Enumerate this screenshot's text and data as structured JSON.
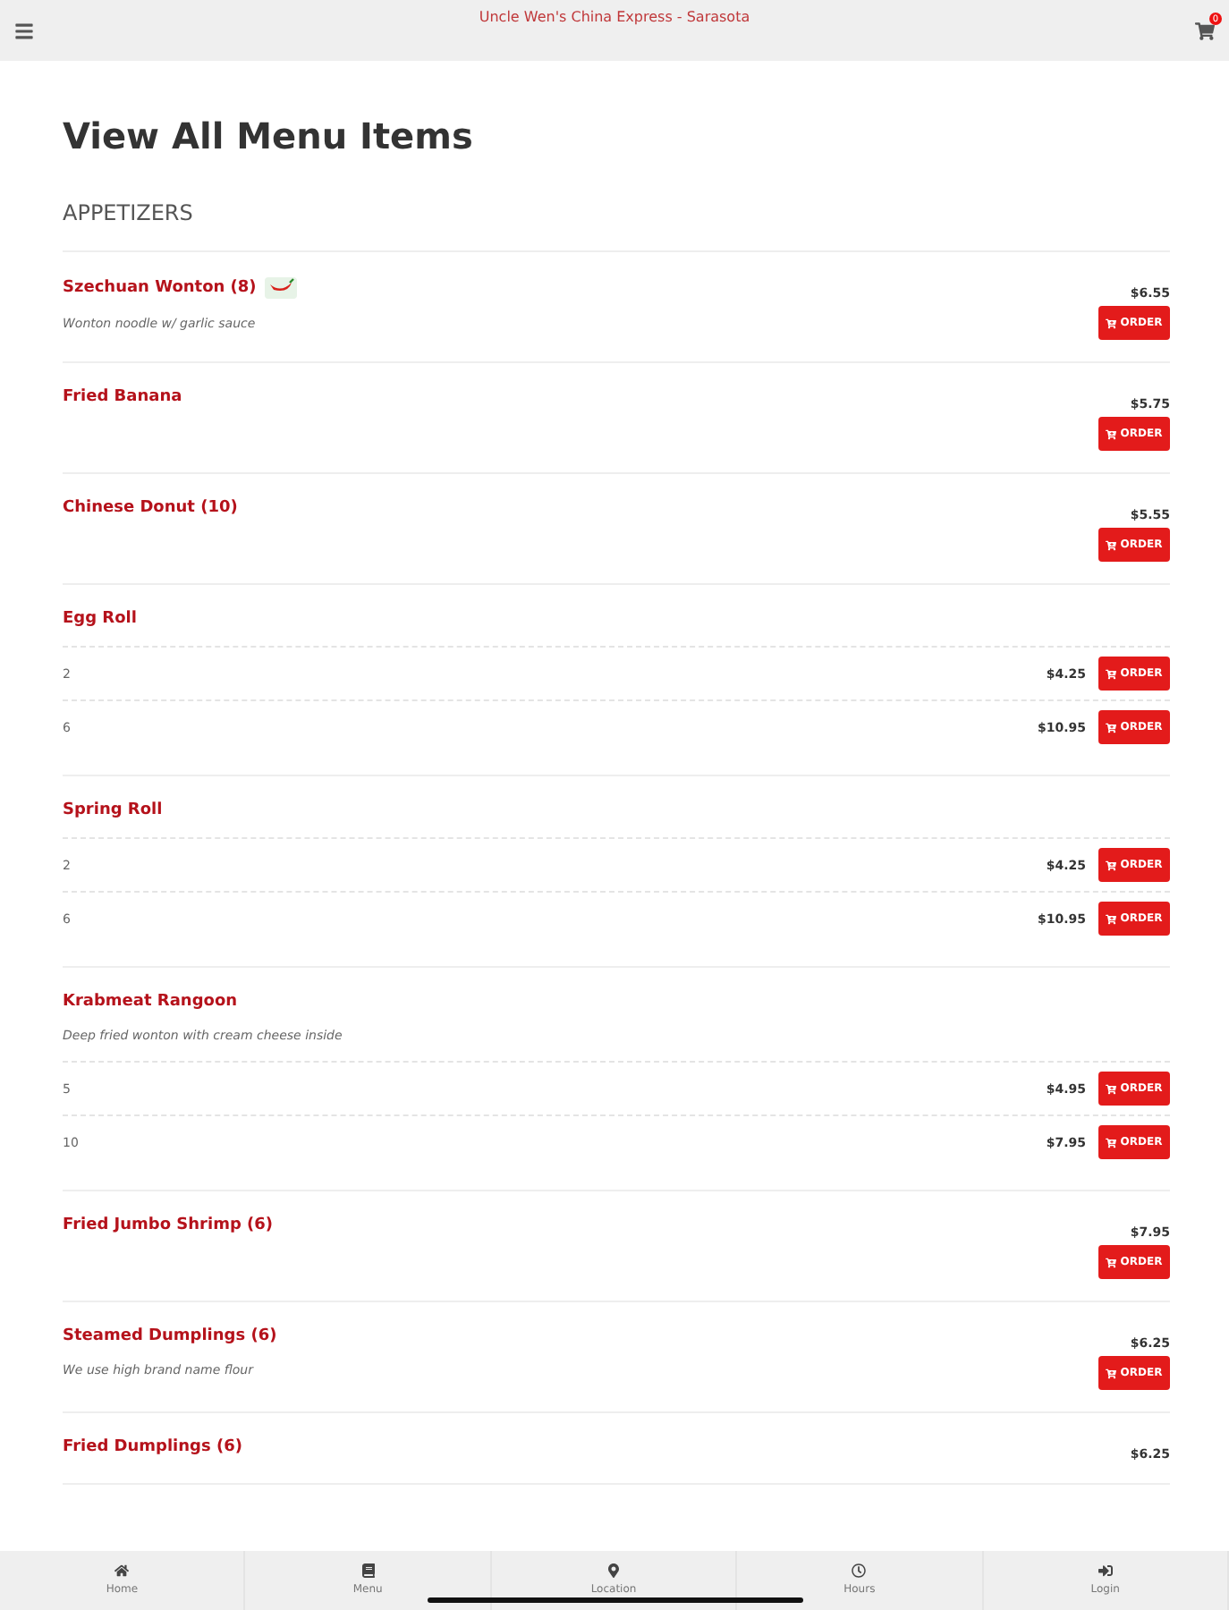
{
  "header": {
    "title": "Uncle Wen's China Express - Sarasota",
    "cart_count": "0"
  },
  "page_title": "View All Menu Items",
  "section": "APPETIZERS",
  "items": [
    {
      "kind": "single",
      "name": "Szechuan Wonton (8)",
      "spicy": true,
      "description": "Wonton noodle w/ garlic sauce",
      "price": "$6.55",
      "order": "ORDER"
    },
    {
      "kind": "single",
      "name": "Fried Banana",
      "spicy": false,
      "price": "$5.75",
      "order": "ORDER"
    },
    {
      "kind": "single",
      "name": "Chinese Donut (10)",
      "spicy": false,
      "price": "$5.55",
      "order": "ORDER"
    },
    {
      "kind": "multi",
      "name": "Egg Roll",
      "spicy": false,
      "options": [
        {
          "size": "2",
          "price": "$4.25",
          "order": "ORDER"
        },
        {
          "size": "6",
          "price": "$10.95",
          "order": "ORDER"
        }
      ]
    },
    {
      "kind": "multi",
      "name": "Spring Roll",
      "spicy": false,
      "options": [
        {
          "size": "2",
          "price": "$4.25",
          "order": "ORDER"
        },
        {
          "size": "6",
          "price": "$10.95",
          "order": "ORDER"
        }
      ]
    },
    {
      "kind": "multi",
      "name": "Krabmeat Rangoon",
      "spicy": false,
      "description": "Deep fried wonton with cream cheese inside",
      "options": [
        {
          "size": "5",
          "price": "$4.95",
          "order": "ORDER"
        },
        {
          "size": "10",
          "price": "$7.95",
          "order": "ORDER"
        }
      ]
    },
    {
      "kind": "single",
      "name": "Fried Jumbo Shrimp (6)",
      "spicy": false,
      "price": "$7.95",
      "order": "ORDER"
    },
    {
      "kind": "single",
      "name": "Steamed Dumplings (6)",
      "spicy": false,
      "description": "We use high brand name flour",
      "price": "$6.25",
      "order": "ORDER"
    },
    {
      "kind": "single",
      "name": "Fried Dumplings (6)",
      "spicy": false,
      "price": "$6.25"
    }
  ],
  "nav": [
    {
      "kind": "home",
      "label": "Home"
    },
    {
      "kind": "menu",
      "label": "Menu"
    },
    {
      "kind": "location",
      "label": "Location"
    },
    {
      "kind": "hours",
      "label": "Hours"
    },
    {
      "kind": "login",
      "label": "Login"
    }
  ]
}
